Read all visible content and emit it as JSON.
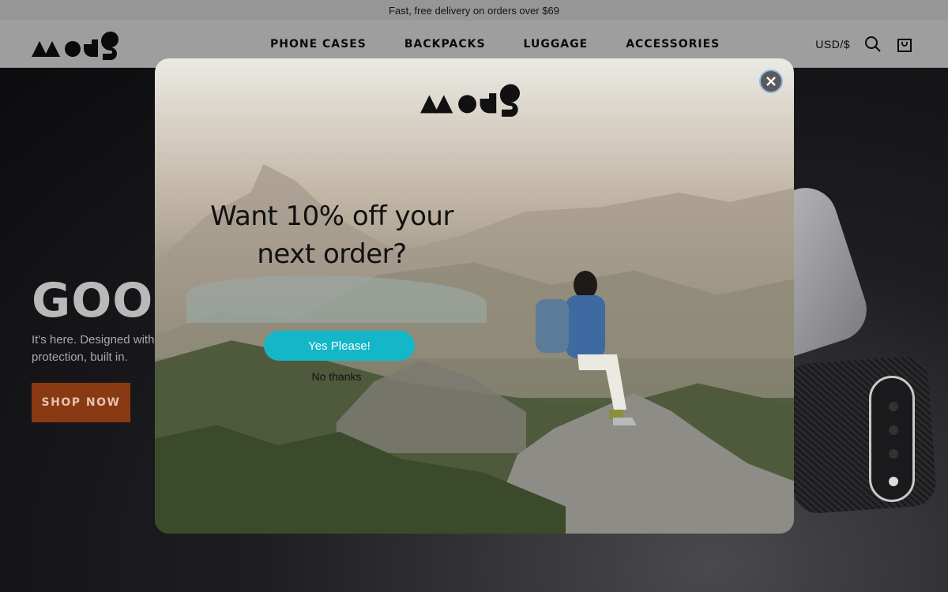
{
  "announcement": {
    "text": "Fast, free delivery on orders over $69"
  },
  "header": {
    "nav": [
      "PHONE CASES",
      "BACKPACKS",
      "LUGGAGE",
      "ACCESSORIES"
    ],
    "currency": "USD/$",
    "search_icon": "search-icon",
    "cart_icon": "shopping-bag-icon"
  },
  "hero": {
    "title": "GOOGL",
    "subtitle": "It's here. Designed with protection, built in.",
    "cta": "SHOP NOW",
    "cta_color": "#8a3a12"
  },
  "popup": {
    "headline": "Want 10% off your next order?",
    "primary_button": "Yes Please!",
    "primary_color": "#14b7c7",
    "secondary_link": "No thanks",
    "close_icon": "close-icon"
  }
}
